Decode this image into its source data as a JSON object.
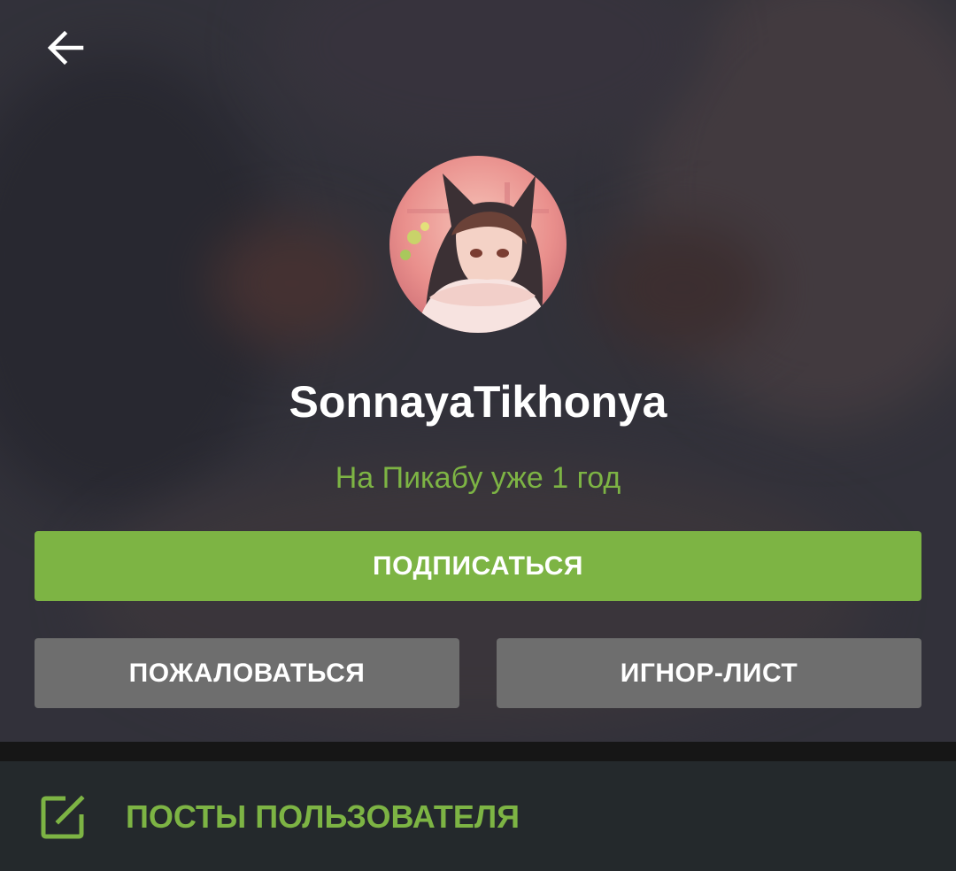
{
  "header": {
    "back_icon": "arrow-left-icon"
  },
  "profile": {
    "username": "SonnayaTikhonya",
    "member_since": "На Пикабу уже 1 год"
  },
  "actions": {
    "subscribe_label": "ПОДПИСАТЬСЯ",
    "report_label": "ПОЖАЛОВАТЬСЯ",
    "ignore_label": "ИГНОР-ЛИСТ"
  },
  "menu": {
    "posts_label": "ПОСТЫ ПОЛЬЗОВАТЕЛЯ",
    "posts_icon": "edit-square-icon"
  },
  "colors": {
    "accent": "#7db444",
    "secondary_button": "#6e6e6e",
    "menu_background": "#24292c"
  }
}
